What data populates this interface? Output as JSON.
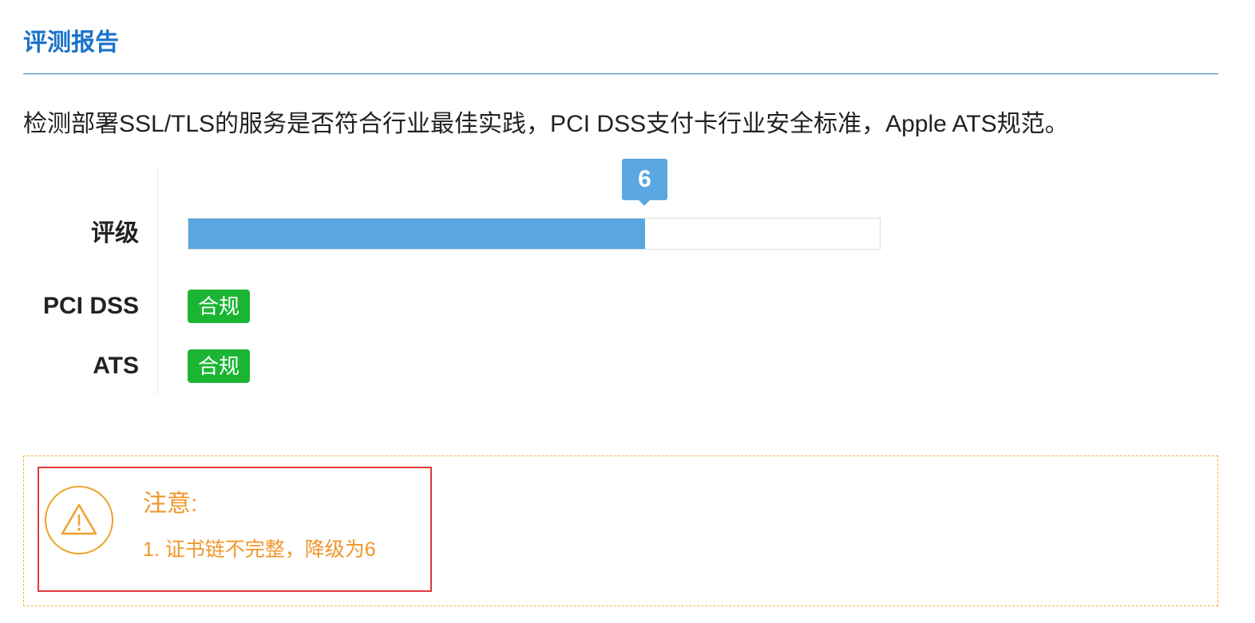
{
  "header": {
    "title": "评测报告"
  },
  "description": "检测部署SSL/TLS的服务是否符合行业最佳实践，PCI DSS支付卡行业安全标准，Apple ATS规范。",
  "rating": {
    "label": "评级",
    "score": "6",
    "fill_fraction": 0.66,
    "bar_color": "#5aa7e2"
  },
  "compliance": [
    {
      "label": "PCI DSS",
      "status": "合规"
    },
    {
      "label": "ATS",
      "status": "合规"
    }
  ],
  "colors": {
    "title": "#1a73c8",
    "compliant_badge": "#1bb533",
    "warning": "#f0962a",
    "highlight": "#e0393b"
  },
  "notice": {
    "icon": "warning-icon",
    "title": "注意:",
    "items": [
      "1. 证书链不完整，降级为6"
    ]
  }
}
